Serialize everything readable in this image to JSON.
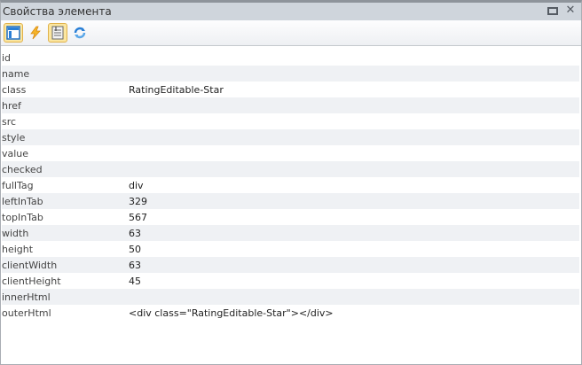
{
  "title": "Свойства элемента",
  "toolbar": [
    {
      "name": "element-view-icon",
      "active": true
    },
    {
      "name": "lightning-icon",
      "active": false
    },
    {
      "name": "properties-icon",
      "active": true
    },
    {
      "name": "refresh-icon",
      "active": false
    }
  ],
  "properties": [
    {
      "key": "id",
      "value": ""
    },
    {
      "key": "name",
      "value": ""
    },
    {
      "key": "class",
      "value": "RatingEditable-Star"
    },
    {
      "key": "href",
      "value": ""
    },
    {
      "key": "src",
      "value": ""
    },
    {
      "key": "style",
      "value": ""
    },
    {
      "key": "value",
      "value": ""
    },
    {
      "key": "checked",
      "value": ""
    },
    {
      "key": "fullTag",
      "value": "div"
    },
    {
      "key": "leftInTab",
      "value": "329"
    },
    {
      "key": "topInTab",
      "value": "567"
    },
    {
      "key": "width",
      "value": "63"
    },
    {
      "key": "height",
      "value": "50"
    },
    {
      "key": "clientWidth",
      "value": "63"
    },
    {
      "key": "clientHeight",
      "value": "45"
    },
    {
      "key": "innerHtml",
      "value": ""
    },
    {
      "key": "outerHtml",
      "value": "<div class=\"RatingEditable-Star\"></div>"
    }
  ]
}
